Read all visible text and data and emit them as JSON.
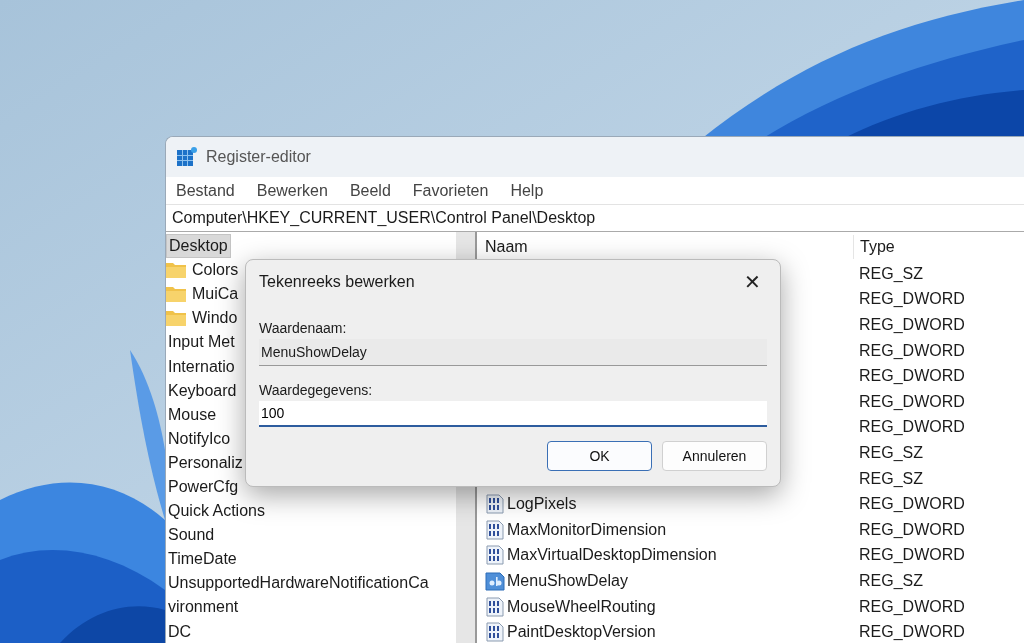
{
  "window": {
    "title": "Register-editor"
  },
  "menu": [
    {
      "label": "Bestand"
    },
    {
      "label": "Bewerken"
    },
    {
      "label": "Beeld"
    },
    {
      "label": "Favorieten"
    },
    {
      "label": "Help"
    }
  ],
  "address": "Computer\\HKEY_CURRENT_USER\\Control Panel\\Desktop",
  "tree": [
    {
      "label": "Desktop",
      "selected": true,
      "children": [
        {
          "label": "Colors",
          "kind": "folder",
          "selected": false
        },
        {
          "label": "MuiCa",
          "kind": "folder",
          "selected": false
        },
        {
          "label": "Windo",
          "kind": "folder",
          "selected": false
        }
      ]
    },
    {
      "label": "Input Met",
      "selected": false
    },
    {
      "label": "Internatio",
      "selected": false
    },
    {
      "label": "Keyboard",
      "selected": false
    },
    {
      "label": "Mouse",
      "selected": false
    },
    {
      "label": "NotifyIco",
      "selected": false
    },
    {
      "label": "Personaliz",
      "selected": false
    },
    {
      "label": "PowerCfg",
      "selected": false
    },
    {
      "label": "Quick Actions",
      "selected": false
    },
    {
      "label": "Sound",
      "selected": false
    },
    {
      "label": "TimeDate",
      "selected": false
    },
    {
      "label": "UnsupportedHardwareNotificationCa",
      "selected": false
    },
    {
      "label": "vironment",
      "selected": false
    },
    {
      "label": "DC",
      "selected": false
    }
  ],
  "list": {
    "columns": [
      "Naam",
      "Type"
    ],
    "rows": [
      {
        "type": "REG_SZ"
      },
      {
        "type": "REG_DWORD"
      },
      {
        "type": "REG_DWORD"
      },
      {
        "type": "REG_DWORD"
      },
      {
        "type": "REG_DWORD"
      },
      {
        "type": "REG_DWORD"
      },
      {
        "type": "REG_DWORD"
      },
      {
        "type": "REG_SZ"
      },
      {
        "type": "REG_SZ"
      },
      {
        "kind": "dword",
        "name": "LogPixels",
        "type": "REG_DWORD"
      },
      {
        "kind": "dword",
        "name": "MaxMonitorDimension",
        "type": "REG_DWORD"
      },
      {
        "kind": "dword",
        "name": "MaxVirtualDesktopDimension",
        "type": "REG_DWORD"
      },
      {
        "kind": "sz",
        "name": "MenuShowDelay",
        "type": "REG_SZ"
      },
      {
        "kind": "dword",
        "name": "MouseWheelRouting",
        "type": "REG_DWORD"
      },
      {
        "kind": "dword",
        "name": "PaintDesktopVersion",
        "type": "REG_DWORD"
      }
    ]
  },
  "dialog": {
    "title": "Tekenreeks bewerken",
    "close": "✕",
    "name_label": "Waardenaam:",
    "name_value": "MenuShowDelay",
    "data_label": "Waardegegevens:",
    "data_value": "100",
    "buttons": [
      {
        "label": "OK",
        "default": true
      },
      {
        "label": "Annuleren",
        "default": false
      }
    ]
  }
}
